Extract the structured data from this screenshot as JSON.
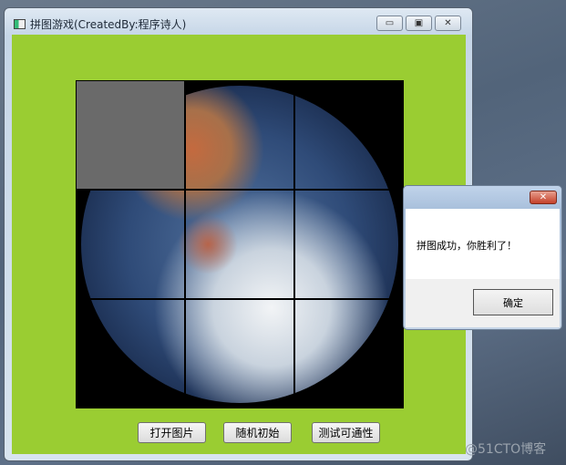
{
  "window": {
    "title": "拼图游戏(CreatedBy:程序诗人)",
    "min": "▭",
    "max": "▣",
    "close": "✕"
  },
  "buttons": {
    "open": "打开图片",
    "random": "随机初始",
    "test": "测试可通性"
  },
  "dialog": {
    "message": "拼图成功，你胜利了！",
    "ok": "确定",
    "close": "✕"
  },
  "watermark": "@51CTO博客",
  "colors": {
    "client": "#9acd32",
    "blank_tile": "#6a6a6a"
  }
}
